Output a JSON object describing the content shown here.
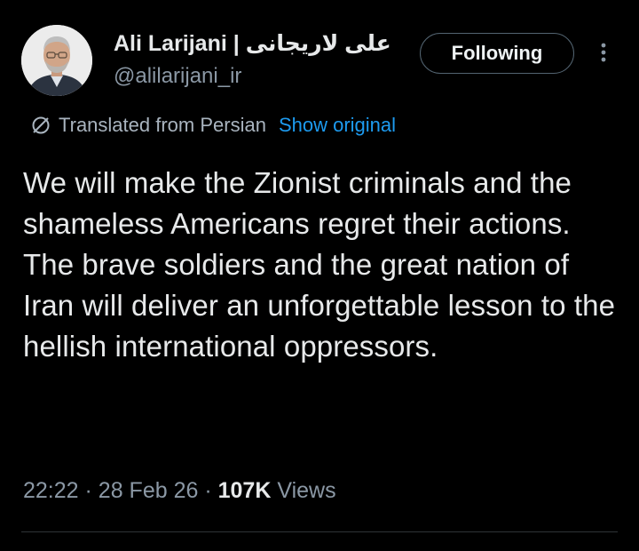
{
  "author": {
    "display_name": "Ali Larijani",
    "separator": "|",
    "display_name_persian": "علی لاریجانی",
    "handle": "@alilarijani_ir",
    "avatar_icon": "profile-photo"
  },
  "follow_button": {
    "label": "Following"
  },
  "more_menu": {
    "icon": "vertical-ellipsis-icon"
  },
  "translation": {
    "icon": "globe-slash-icon",
    "label": "Translated from Persian",
    "show_original_label": "Show original",
    "link_color": "#1d9bf0"
  },
  "tweet": {
    "paragraphs": [
      "We will make the Zionist criminals and the shameless Americans regret their actions.",
      "The brave soldiers and the great nation of Iran will deliver an unforgettable lesson to the hellish international oppressors."
    ]
  },
  "meta": {
    "time": "22:22",
    "dot": "·",
    "date": "28 Feb 26",
    "views_count": "107K",
    "views_label": "Views"
  },
  "colors": {
    "background": "#000000",
    "text_primary": "#e7e9ea",
    "text_secondary": "#8b98a5",
    "border": "#536471"
  }
}
